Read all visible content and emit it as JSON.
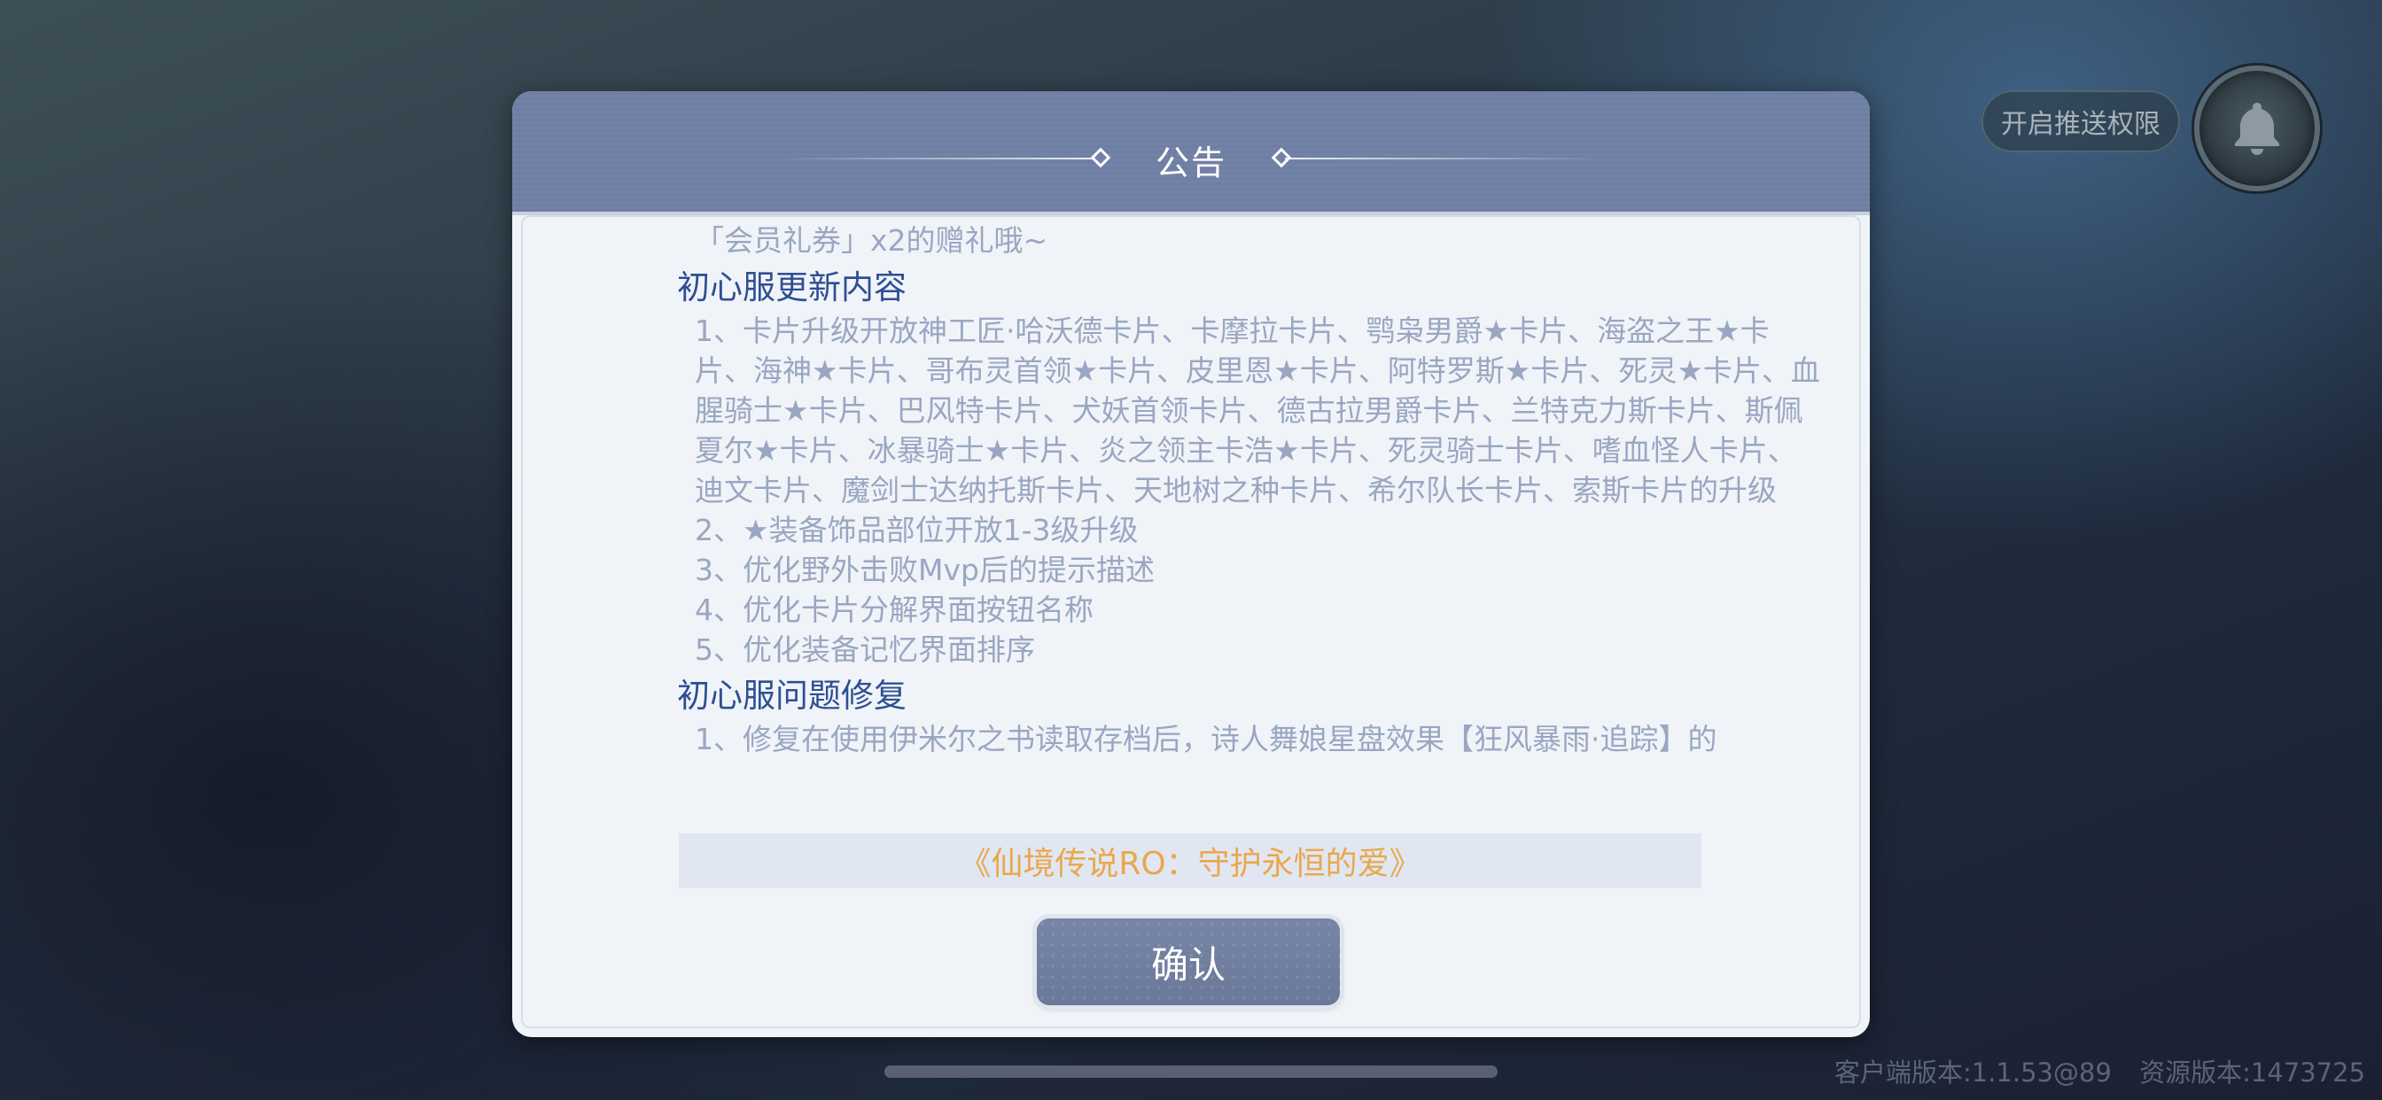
{
  "push_permission": {
    "label": "开启推送权限"
  },
  "notice": {
    "title": "公告",
    "lines": [
      {
        "kind": "text",
        "text": "「会员礼券」x2的赠礼哦~"
      },
      {
        "kind": "section",
        "text": "初心服更新内容"
      },
      {
        "kind": "text",
        "text": "1、卡片升级开放神工匠·哈沃德卡片、卡摩拉卡片、鹗枭男爵★卡片、海盗之王★卡片、海神★卡片、哥布灵首领★卡片、皮里恩★卡片、阿特罗斯★卡片、死灵★卡片、血腥骑士★卡片、巴风特卡片、犬妖首领卡片、德古拉男爵卡片、兰特克力斯卡片、斯佩夏尔★卡片、冰暴骑士★卡片、炎之领主卡浩★卡片、死灵骑士卡片、嗜血怪人卡片、迪文卡片、魔剑士达纳托斯卡片、天地树之种卡片、希尔队长卡片、索斯卡片的升级"
      },
      {
        "kind": "text",
        "text": "2、★装备饰品部位开放1-3级升级"
      },
      {
        "kind": "text",
        "text": "3、优化野外击败Mvp后的提示描述"
      },
      {
        "kind": "text",
        "text": "4、优化卡片分解界面按钮名称"
      },
      {
        "kind": "text",
        "text": "5、优化装备记忆界面排序"
      },
      {
        "kind": "section",
        "text": "初心服问题修复"
      },
      {
        "kind": "text",
        "text": "1、修复在使用伊米尔之书读取存档后，诗人舞娘星盘效果【狂风暴雨·追踪】的"
      }
    ],
    "slogan": "《仙境传说RO：守护永恒的爱》",
    "confirm_label": "确认"
  },
  "footer": {
    "client_version": "客户端版本:1.1.53@89",
    "resource_version": "资源版本:1473725"
  },
  "icons": {
    "bell": "bell-icon",
    "title_ornament": "diamond-icon"
  },
  "colors": {
    "header": "#7383a7",
    "section_title": "#2f4f93",
    "body_text": "#9aa6c2",
    "slogan": "#eba74c",
    "confirm_button": "#6f7d9e"
  }
}
